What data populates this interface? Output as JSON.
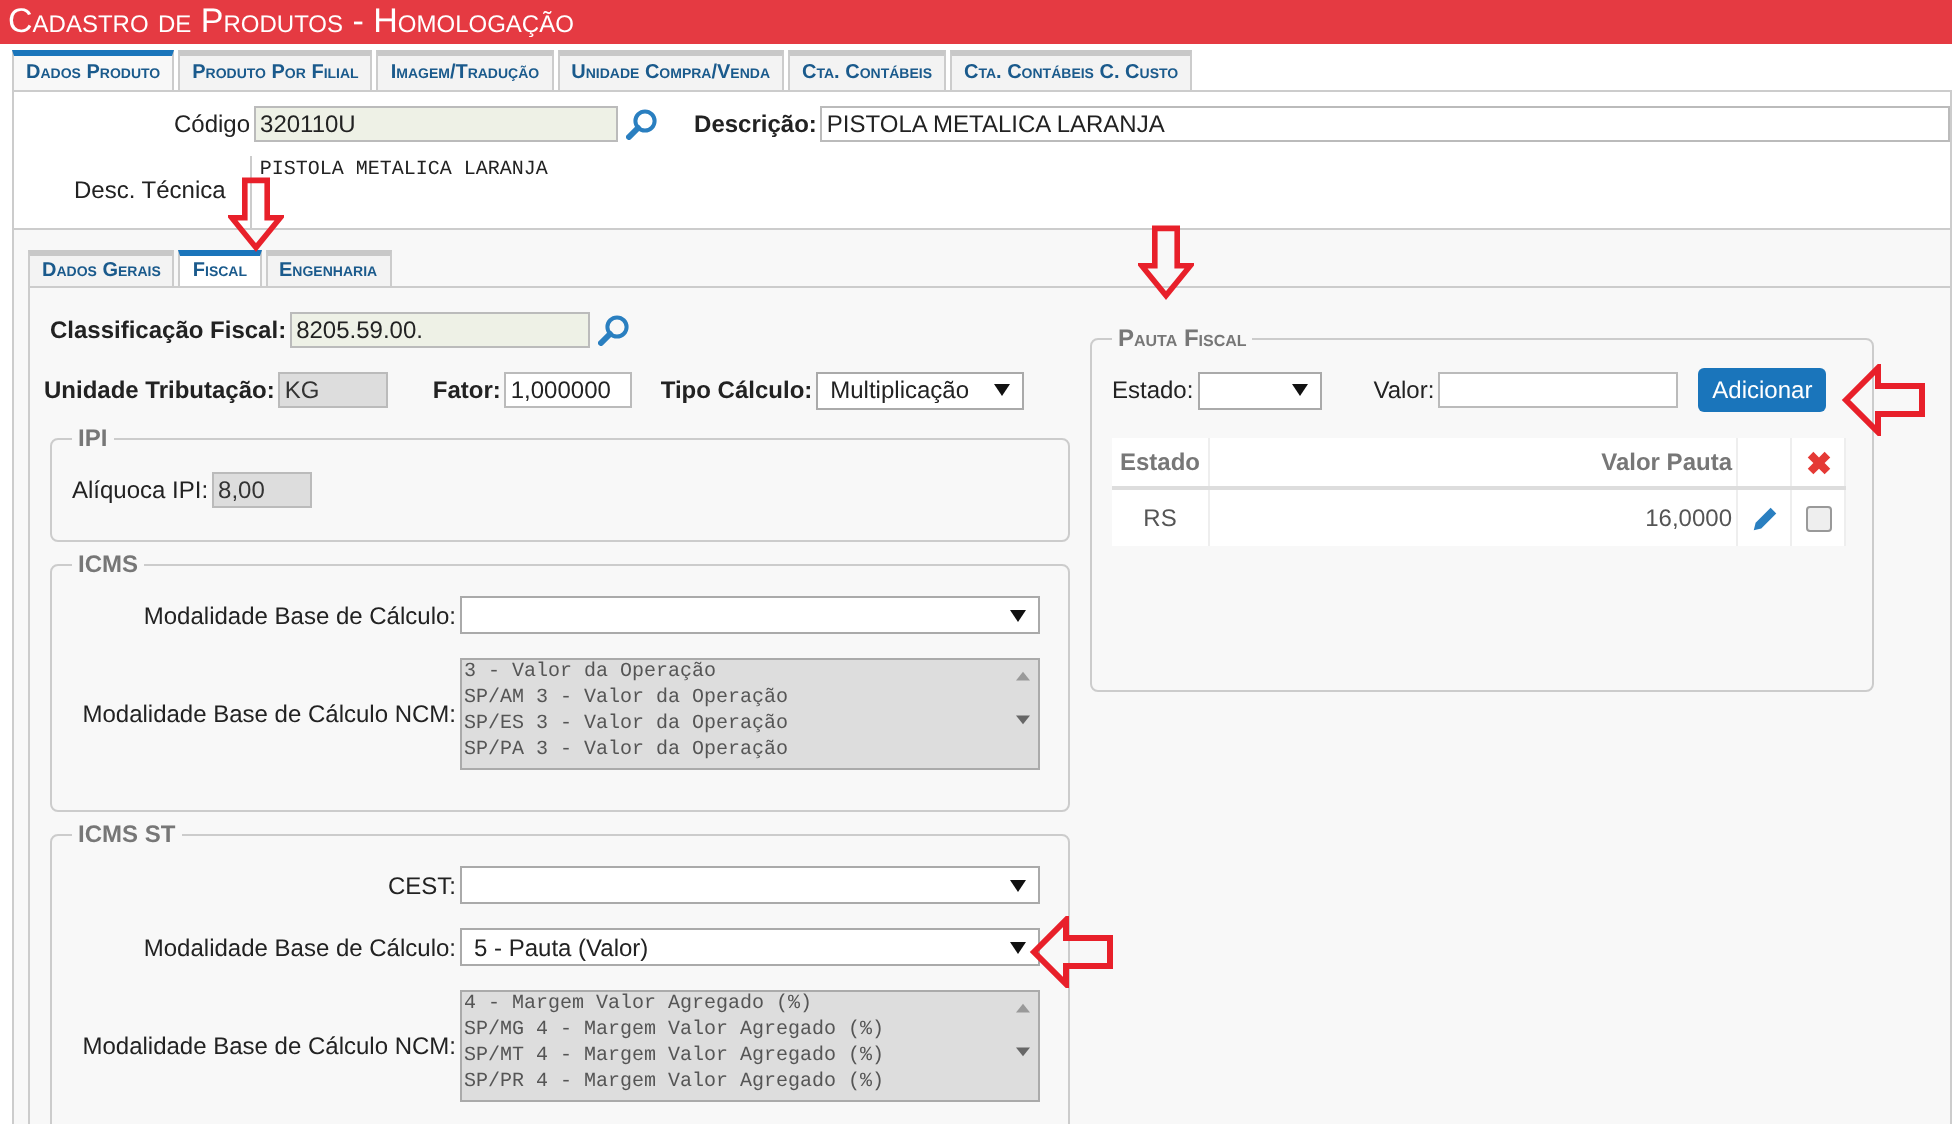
{
  "window": {
    "title": "Cadastro de Produtos  - Homologação"
  },
  "main_tabs": [
    {
      "label": "Dados Produto",
      "selected": true
    },
    {
      "label": "Produto Por Filial",
      "selected": false
    },
    {
      "label": "Imagem/Tradução",
      "selected": false
    },
    {
      "label": "Unidade Compra/Venda",
      "selected": false
    },
    {
      "label": "Cta. Contábeis",
      "selected": false
    },
    {
      "label": "Cta. Contábeis C. Custo",
      "selected": false
    }
  ],
  "produto": {
    "codigo": {
      "label": "Código",
      "value": "320110U"
    },
    "descricao": {
      "label": "Descrição:",
      "value": "PISTOLA METALICA LARANJA"
    },
    "desc_tecnica": {
      "label": "Desc. Técnica",
      "value": "PISTOLA METALICA LARANJA"
    }
  },
  "sub_tabs": [
    {
      "label": "Dados Gerais",
      "selected": false
    },
    {
      "label": "Fiscal",
      "selected": true
    },
    {
      "label": "Engenharia",
      "selected": false
    }
  ],
  "fiscal": {
    "classificacao": {
      "label": "Classificação Fiscal:",
      "value": "8205.59.00."
    },
    "unidade": {
      "label": "Unidade Tributação:",
      "value": "KG",
      "disabled": true
    },
    "fator": {
      "label": "Fator:",
      "value": "1,000000"
    },
    "tipo_calculo": {
      "label": "Tipo Cálculo:",
      "value": "Multiplicação"
    },
    "sections": [
      {
        "title": "IPI",
        "fields": [
          {
            "kind": "input",
            "label": "Alíquoca IPI:",
            "value": "8,00",
            "disabled": true
          }
        ]
      },
      {
        "title": "ICMS",
        "fields": [
          {
            "kind": "select",
            "label": "Modalidade Base de Cálculo:"
          },
          {
            "kind": "listbox",
            "label": "Modalidade Base de Cálculo NCM:",
            "options": [
              "3 - Valor da Operação",
              "SP/AM 3 - Valor da Operação",
              "SP/ES 3 - Valor da Operação",
              "SP/PA 3 - Valor da Operação"
            ]
          }
        ]
      },
      {
        "title": "ICMS ST",
        "fields": [
          {
            "kind": "select",
            "label": "CEST:"
          },
          {
            "kind": "select",
            "label": "Modalidade Base de Cálculo:",
            "value": "5 - Pauta (Valor)"
          },
          {
            "kind": "listbox",
            "label": "Modalidade Base de Cálculo NCM:",
            "options": [
              "4 - Margem Valor Agregado (%)",
              "SP/MG 4 - Margem Valor Agregado (%)",
              "SP/MT 4 - Margem Valor Agregado (%)",
              "SP/PR 4 - Margem Valor Agregado (%)"
            ]
          }
        ]
      }
    ]
  },
  "pauta": {
    "title": "Pauta Fiscal",
    "estado_label": "Estado:",
    "valor_label": "Valor:",
    "button": "Adicionar",
    "columns": [
      "Estado",
      "Valor Pauta"
    ],
    "rows": [
      {
        "estado": "RS",
        "valor": "16,0000",
        "checked": false
      }
    ]
  }
}
